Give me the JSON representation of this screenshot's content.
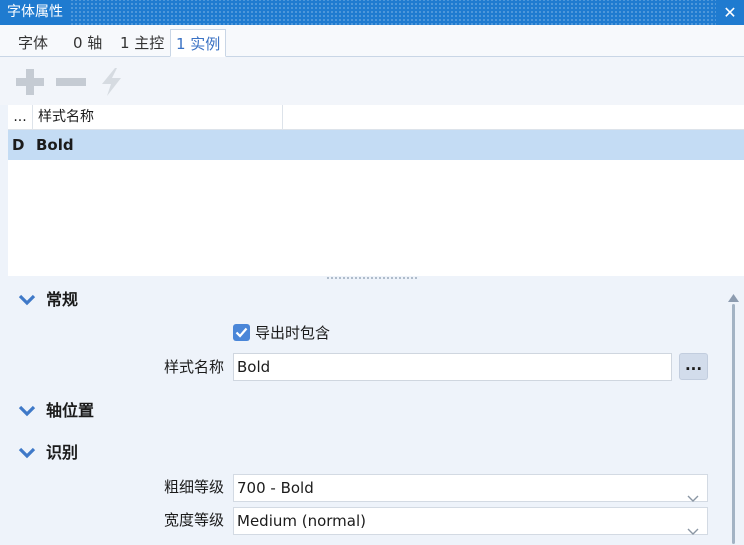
{
  "window": {
    "title": "字体属性",
    "close_glyph": "✕"
  },
  "tabs": [
    {
      "label": "字体"
    },
    {
      "label": "0 轴"
    },
    {
      "label": "1 主控"
    },
    {
      "label": "1 实例",
      "active": true
    }
  ],
  "toolbar": {
    "add_icon": "plus-icon",
    "remove_icon": "minus-icon",
    "action_icon": "lightning-icon"
  },
  "list": {
    "columns": [
      "...",
      "样式名称"
    ],
    "rows": [
      {
        "code": "D",
        "name": "Bold",
        "selected": true
      }
    ]
  },
  "sections": {
    "general": {
      "title": "常规",
      "export_checkbox": {
        "label": "导出时包含",
        "checked": true
      },
      "style_name": {
        "label": "样式名称",
        "value": "Bold",
        "button": "..."
      }
    },
    "axis_position": {
      "title": "轴位置"
    },
    "identification": {
      "title": "识别",
      "weight_class": {
        "label": "粗细等级",
        "value": "700 - Bold"
      },
      "width_class": {
        "label": "宽度等级",
        "value": "Medium (normal)"
      }
    }
  },
  "colors": {
    "titlebar": "#1f7bd0",
    "active_tab_text": "#3a72c4",
    "selection": "#c4dcf4",
    "panel_background": "#eef3fa",
    "checkbox": "#4a86d8",
    "chevron": "#3f79c8"
  }
}
